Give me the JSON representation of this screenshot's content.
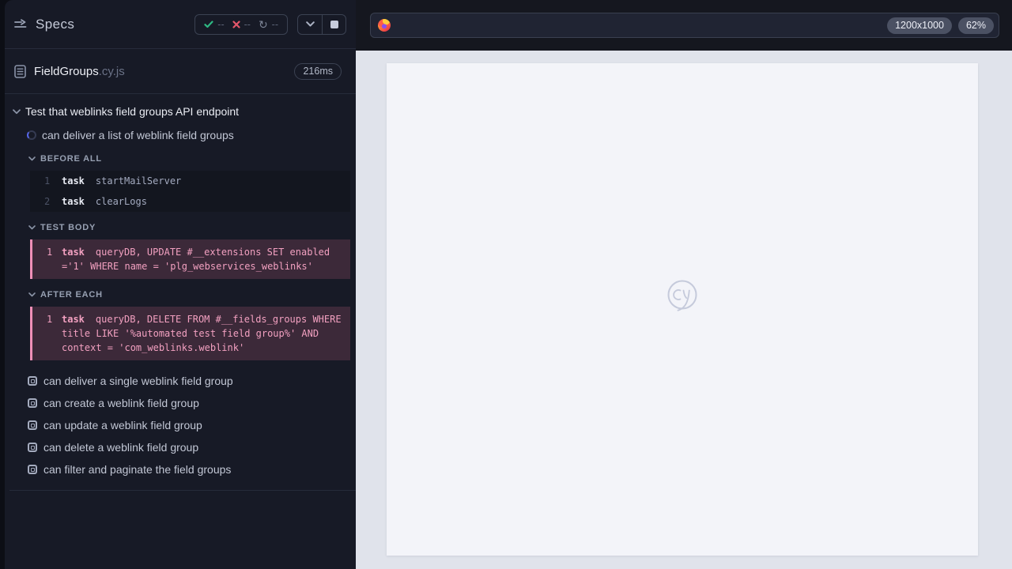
{
  "sidebar": {
    "title": "Specs",
    "stats": {
      "passed_count": "--",
      "failed_count": "--",
      "running_count": "--",
      "refresh_glyph": "↻"
    },
    "spec": {
      "name": "FieldGroups",
      "ext": ".cy.js",
      "duration": "216ms"
    },
    "suite_title": "Test that weblinks field groups API endpoint",
    "running_test": "can deliver a list of weblink field groups",
    "sections": [
      {
        "label": "BEFORE ALL",
        "commands": [
          {
            "num": "1",
            "method": "task",
            "message": "startMailServer"
          },
          {
            "num": "2",
            "method": "task",
            "message": "clearLogs"
          }
        ]
      },
      {
        "label": "TEST BODY",
        "commands": [
          {
            "num": "1",
            "method": "task",
            "message": "queryDB, UPDATE #__extensions SET enabled ='1' WHERE name = 'plg_webservices_weblinks'"
          }
        ]
      },
      {
        "label": "AFTER EACH",
        "commands": [
          {
            "num": "1",
            "method": "task",
            "message": "queryDB, DELETE FROM #__fields_groups WHERE title LIKE '%automated test field group%' AND context = 'com_weblinks.weblink'"
          }
        ]
      }
    ],
    "pending_tests": [
      "can deliver a single weblink field group",
      "can create a weblink field group",
      "can update a weblink field group",
      "can delete a weblink field group",
      "can filter and paginate the field groups"
    ]
  },
  "browser": {
    "viewport_size": "1200x1000",
    "zoom_level": "62%"
  },
  "canvas": {
    "watermark": "cy"
  },
  "colors": {
    "accent_pink": "#f2a0c0",
    "pass_green": "#2eb883",
    "fail_red": "#e4566a",
    "running_blue": "#5767ea",
    "sidebar_bg": "#171a26",
    "stage_bg": "#e0e3eb",
    "aut_bg": "#f3f4f9"
  }
}
